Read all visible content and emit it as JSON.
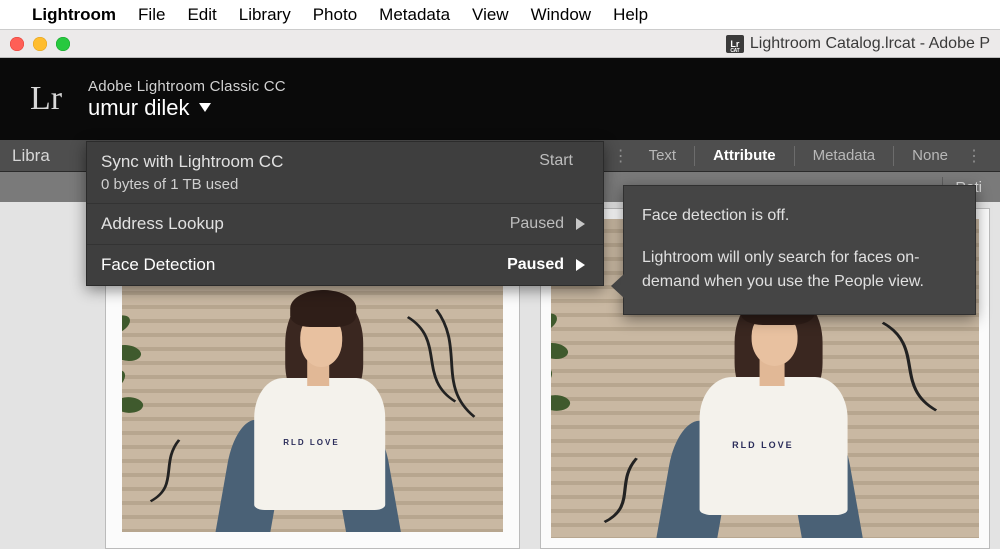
{
  "menubar": {
    "app": "Lightroom",
    "items": [
      "File",
      "Edit",
      "Library",
      "Photo",
      "Metadata",
      "View",
      "Window",
      "Help"
    ]
  },
  "titlebar": {
    "doc_icon_top": "Lr",
    "doc_icon_sub": "CAT",
    "title": "Lightroom Catalog.lrcat - Adobe P"
  },
  "header": {
    "logo": "Lr",
    "product": "Adobe Lightroom Classic CC",
    "user": "umur dilek"
  },
  "filterbar": {
    "left_label": "Libra",
    "tabs": {
      "text": "Text",
      "attribute": "Attribute",
      "metadata": "Metadata",
      "none": "None"
    },
    "sub_right": "Rati"
  },
  "sync_panel": {
    "row1": {
      "title": "Sync with Lightroom CC",
      "sub": "0 bytes of 1 TB used",
      "status": "Start"
    },
    "row2": {
      "title": "Address Lookup",
      "status": "Paused"
    },
    "row3": {
      "title": "Face Detection",
      "status": "Paused"
    }
  },
  "tooltip": {
    "title": "Face detection is off.",
    "body": "Lightroom will only search for faces on-demand when you use the People view."
  },
  "thumb": {
    "shirt_text": "RLD LOVE"
  }
}
